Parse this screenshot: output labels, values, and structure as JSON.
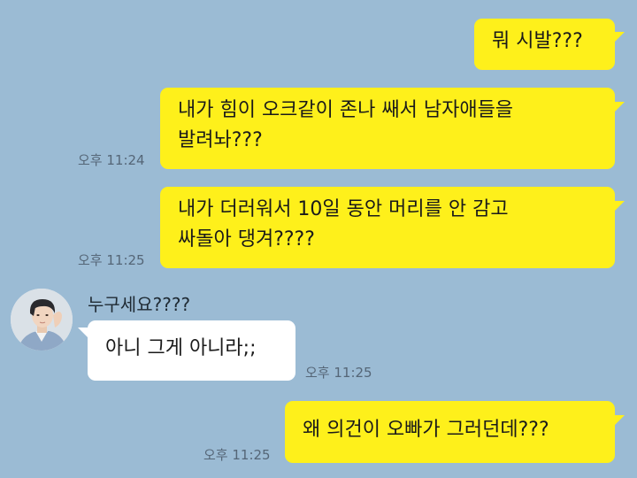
{
  "colors": {
    "background": "#9bbbd4",
    "my_bubble": "#fef01b",
    "other_bubble": "#ffffff"
  },
  "messages": {
    "m1": {
      "text": "뭐 시발???"
    },
    "m2": {
      "line1": "내가 힘이 오크같이 존나 쌔서 남자애들을",
      "line2": "발려놔???",
      "time": "오후 11:24"
    },
    "m3": {
      "line1": "내가 더러워서 10일 동안 머리를 안 감고",
      "line2": "싸돌아 댕겨????",
      "time": "오후 11:25"
    },
    "m4": {
      "sender": "누구세요????",
      "text": "아니 그게 아니라;;",
      "time": "오후 11:25",
      "avatar_icon": "profile-photo"
    },
    "m5": {
      "text": "왜 의건이 오빠가 그러던데???",
      "time": "오후 11:25"
    }
  }
}
